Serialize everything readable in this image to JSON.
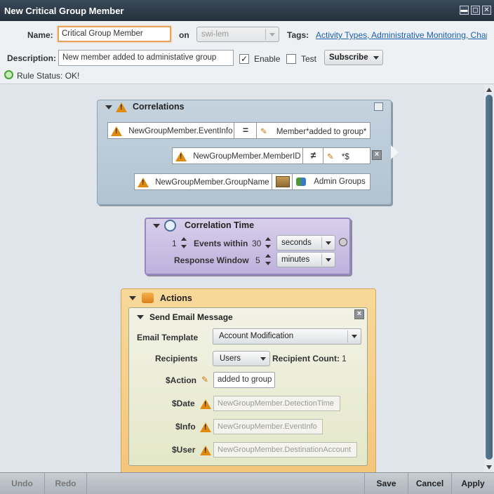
{
  "window": {
    "title": "New Critical Group Member",
    "btn_minimize": "▬",
    "btn_restore": "◻",
    "btn_close": "✕"
  },
  "form": {
    "name_label": "Name:",
    "name_value": "Critical Group Member",
    "on_label": "on",
    "on_value": "swi-lem",
    "tags_label": "Tags:",
    "tags_value": "Activity Types, Administrative Monitoring, Chan...",
    "description_label": "Description:",
    "description_value": "New member added to administative group",
    "enable_label": "Enable",
    "enable_checked": "✓",
    "test_label": "Test",
    "subscribe_label": "Subscribe",
    "rule_status": "Rule Status: OK!"
  },
  "correlations": {
    "title": "Correlations",
    "rows": [
      {
        "field": "NewGroupMember.EventInfo",
        "operator": "=",
        "value": "Member*added to group*"
      },
      {
        "field": "NewGroupMember.MemberID",
        "operator": "≠",
        "value": "*$"
      },
      {
        "field": "NewGroupMember.GroupName",
        "operator": "",
        "value": "Admin Groups"
      }
    ]
  },
  "correlation_time": {
    "title": "Correlation Time",
    "events_count": "1",
    "events_label": "Events within",
    "within_value": "30",
    "within_unit": "seconds",
    "response_label": "Response Window",
    "response_value": "5",
    "response_unit": "minutes"
  },
  "actions": {
    "title": "Actions",
    "email": {
      "title": "Send Email Message",
      "template_label": "Email Template",
      "template_value": "Account Modification",
      "recipients_label": "Recipients",
      "recipients_value": "Users",
      "recipient_count_label": "Recipient Count:",
      "recipient_count_value": "1",
      "params": [
        {
          "label": "$Action",
          "value": "added to group"
        },
        {
          "label": "$Date",
          "value": "NewGroupMember.DetectionTime"
        },
        {
          "label": "$Info",
          "value": "NewGroupMember.EventInfo"
        },
        {
          "label": "$User",
          "value": "NewGroupMember.DestinationAccount"
        }
      ]
    }
  },
  "bottom": {
    "undo": "Undo",
    "redo": "Redo",
    "save": "Save",
    "cancel": "Cancel",
    "apply": "Apply"
  },
  "colors": {
    "accent_focus": "#e8a35a",
    "link": "#1a5fb0",
    "warning": "#e08a10"
  }
}
